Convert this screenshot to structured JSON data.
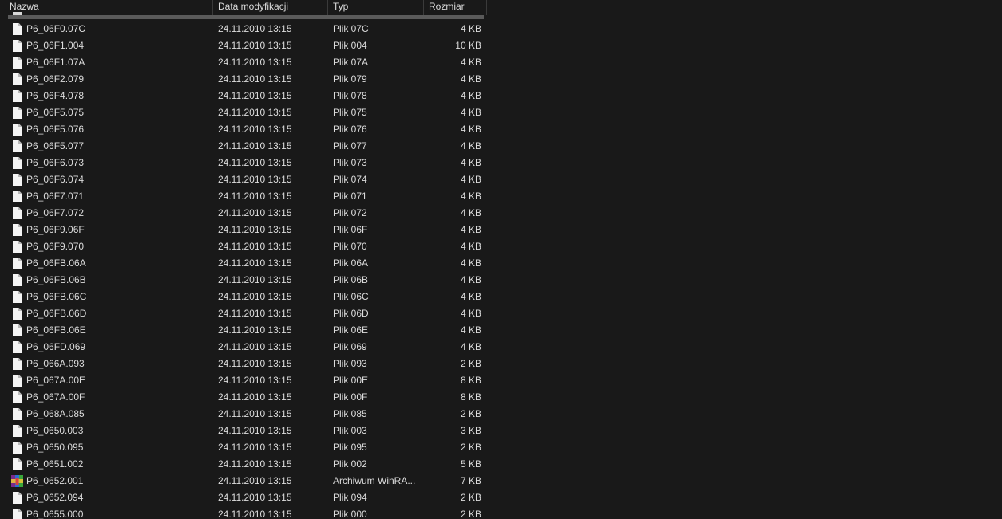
{
  "columns": {
    "name": "Nazwa",
    "date": "Data modyfikacji",
    "type": "Typ",
    "size": "Rozmiar"
  },
  "files": [
    {
      "name": "P6_06F0.07C",
      "date": "24.11.2010 13:15",
      "type": "Plik 07C",
      "size": "4 KB",
      "icon": "file-icon"
    },
    {
      "name": "P6_06F1.004",
      "date": "24.11.2010 13:15",
      "type": "Plik 004",
      "size": "10 KB",
      "icon": "file-icon"
    },
    {
      "name": "P6_06F1.07A",
      "date": "24.11.2010 13:15",
      "type": "Plik 07A",
      "size": "4 KB",
      "icon": "file-icon"
    },
    {
      "name": "P6_06F2.079",
      "date": "24.11.2010 13:15",
      "type": "Plik 079",
      "size": "4 KB",
      "icon": "file-icon"
    },
    {
      "name": "P6_06F4.078",
      "date": "24.11.2010 13:15",
      "type": "Plik 078",
      "size": "4 KB",
      "icon": "file-icon"
    },
    {
      "name": "P6_06F5.075",
      "date": "24.11.2010 13:15",
      "type": "Plik 075",
      "size": "4 KB",
      "icon": "file-icon"
    },
    {
      "name": "P6_06F5.076",
      "date": "24.11.2010 13:15",
      "type": "Plik 076",
      "size": "4 KB",
      "icon": "file-icon"
    },
    {
      "name": "P6_06F5.077",
      "date": "24.11.2010 13:15",
      "type": "Plik 077",
      "size": "4 KB",
      "icon": "file-icon"
    },
    {
      "name": "P6_06F6.073",
      "date": "24.11.2010 13:15",
      "type": "Plik 073",
      "size": "4 KB",
      "icon": "file-icon"
    },
    {
      "name": "P6_06F6.074",
      "date": "24.11.2010 13:15",
      "type": "Plik 074",
      "size": "4 KB",
      "icon": "file-icon"
    },
    {
      "name": "P6_06F7.071",
      "date": "24.11.2010 13:15",
      "type": "Plik 071",
      "size": "4 KB",
      "icon": "file-icon"
    },
    {
      "name": "P6_06F7.072",
      "date": "24.11.2010 13:15",
      "type": "Plik 072",
      "size": "4 KB",
      "icon": "file-icon"
    },
    {
      "name": "P6_06F9.06F",
      "date": "24.11.2010 13:15",
      "type": "Plik 06F",
      "size": "4 KB",
      "icon": "file-icon"
    },
    {
      "name": "P6_06F9.070",
      "date": "24.11.2010 13:15",
      "type": "Plik 070",
      "size": "4 KB",
      "icon": "file-icon"
    },
    {
      "name": "P6_06FB.06A",
      "date": "24.11.2010 13:15",
      "type": "Plik 06A",
      "size": "4 KB",
      "icon": "file-icon"
    },
    {
      "name": "P6_06FB.06B",
      "date": "24.11.2010 13:15",
      "type": "Plik 06B",
      "size": "4 KB",
      "icon": "file-icon"
    },
    {
      "name": "P6_06FB.06C",
      "date": "24.11.2010 13:15",
      "type": "Plik 06C",
      "size": "4 KB",
      "icon": "file-icon"
    },
    {
      "name": "P6_06FB.06D",
      "date": "24.11.2010 13:15",
      "type": "Plik 06D",
      "size": "4 KB",
      "icon": "file-icon"
    },
    {
      "name": "P6_06FB.06E",
      "date": "24.11.2010 13:15",
      "type": "Plik 06E",
      "size": "4 KB",
      "icon": "file-icon"
    },
    {
      "name": "P6_06FD.069",
      "date": "24.11.2010 13:15",
      "type": "Plik 069",
      "size": "4 KB",
      "icon": "file-icon"
    },
    {
      "name": "P6_066A.093",
      "date": "24.11.2010 13:15",
      "type": "Plik 093",
      "size": "2 KB",
      "icon": "file-icon"
    },
    {
      "name": "P6_067A.00E",
      "date": "24.11.2010 13:15",
      "type": "Plik 00E",
      "size": "8 KB",
      "icon": "file-icon"
    },
    {
      "name": "P6_067A.00F",
      "date": "24.11.2010 13:15",
      "type": "Plik 00F",
      "size": "8 KB",
      "icon": "file-icon"
    },
    {
      "name": "P6_068A.085",
      "date": "24.11.2010 13:15",
      "type": "Plik 085",
      "size": "2 KB",
      "icon": "file-icon"
    },
    {
      "name": "P6_0650.003",
      "date": "24.11.2010 13:15",
      "type": "Plik 003",
      "size": "3 KB",
      "icon": "file-icon"
    },
    {
      "name": "P6_0650.095",
      "date": "24.11.2010 13:15",
      "type": "Plik 095",
      "size": "2 KB",
      "icon": "file-icon"
    },
    {
      "name": "P6_0651.002",
      "date": "24.11.2010 13:15",
      "type": "Plik 002",
      "size": "5 KB",
      "icon": "file-icon"
    },
    {
      "name": "P6_0652.001",
      "date": "24.11.2010 13:15",
      "type": "Archiwum WinRA...",
      "size": "7 KB",
      "icon": "winrar-archive-icon"
    },
    {
      "name": "P6_0652.094",
      "date": "24.11.2010 13:15",
      "type": "Plik 094",
      "size": "2 KB",
      "icon": "file-icon"
    },
    {
      "name": "P6_0655.000",
      "date": "24.11.2010 13:15",
      "type": "Plik 000",
      "size": "2 KB",
      "icon": "file-icon"
    }
  ]
}
